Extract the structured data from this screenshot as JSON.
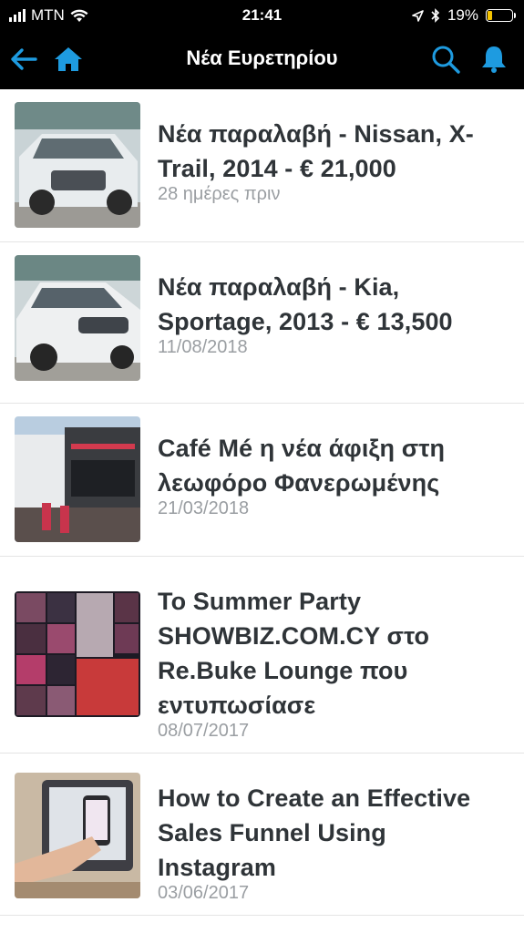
{
  "status": {
    "carrier": "MTN",
    "time": "21:41",
    "battery": "19%",
    "battery_level": 0.19
  },
  "nav": {
    "title": "Νέα Ευρετηρίου",
    "back_icon": "back-arrow-icon",
    "home_icon": "home-icon",
    "search_icon": "search-icon",
    "bell_icon": "bell-icon",
    "accent": "#1e9be0"
  },
  "articles": [
    {
      "title": "Νέα παραλαβή - Nissan, X-Trail, 2014 - € 21,000",
      "date": "28 ημέρες πριν"
    },
    {
      "title": "Νέα παραλαβή - Kia, Sportage, 2013 - € 13,500",
      "date": "11/08/2018"
    },
    {
      "title": "Café Mé η νέα άφιξη στη λεωφόρο Φανερωμένης",
      "date": "21/03/2018"
    },
    {
      "title": "To Summer Party SHOWBIZ.COM.CY στο Re.Buke Lounge που εντυπωσίασε",
      "date": "08/07/2017"
    },
    {
      "title": "How to Create an Effective Sales Funnel Using Instagram",
      "date": "03/06/2017"
    }
  ]
}
